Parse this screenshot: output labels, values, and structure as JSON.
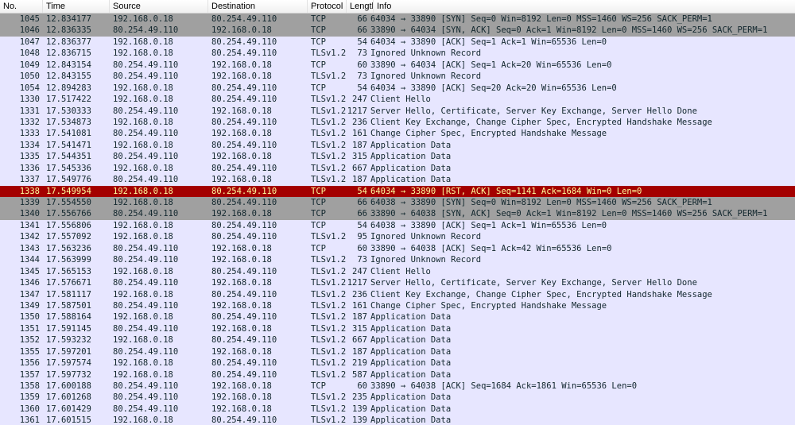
{
  "columns": {
    "no": "No.",
    "time": "Time",
    "source": "Source",
    "destination": "Destination",
    "protocol": "Protocol",
    "length": "Length",
    "info": "Info"
  },
  "colors": {
    "normal_bg": "#e7e6ff",
    "syn_bg": "#a0a0a0",
    "rst_bg": "#a40000",
    "rst_fg": "#fffc9c"
  },
  "packets": [
    {
      "no": "1045",
      "time": "12.834177",
      "src": "192.168.0.18",
      "dst": "80.254.49.110",
      "proto": "TCP",
      "len": "66",
      "info": "64034 → 33890 [SYN] Seq=0 Win=8192 Len=0 MSS=1460 WS=256 SACK_PERM=1",
      "style": "syn"
    },
    {
      "no": "1046",
      "time": "12.836335",
      "src": "80.254.49.110",
      "dst": "192.168.0.18",
      "proto": "TCP",
      "len": "66",
      "info": "33890 → 64034 [SYN, ACK] Seq=0 Ack=1 Win=8192 Len=0 MSS=1460 WS=256 SACK_PERM=1",
      "style": "syn"
    },
    {
      "no": "1047",
      "time": "12.836377",
      "src": "192.168.0.18",
      "dst": "80.254.49.110",
      "proto": "TCP",
      "len": "54",
      "info": "64034 → 33890 [ACK] Seq=1 Ack=1 Win=65536 Len=0",
      "style": "tcp"
    },
    {
      "no": "1048",
      "time": "12.836715",
      "src": "192.168.0.18",
      "dst": "80.254.49.110",
      "proto": "TLSv1.2",
      "len": "73",
      "info": "Ignored Unknown Record",
      "style": "tls"
    },
    {
      "no": "1049",
      "time": "12.843154",
      "src": "80.254.49.110",
      "dst": "192.168.0.18",
      "proto": "TCP",
      "len": "60",
      "info": "33890 → 64034 [ACK] Seq=1 Ack=20 Win=65536 Len=0",
      "style": "tcp"
    },
    {
      "no": "1050",
      "time": "12.843155",
      "src": "80.254.49.110",
      "dst": "192.168.0.18",
      "proto": "TLSv1.2",
      "len": "73",
      "info": "Ignored Unknown Record",
      "style": "tls"
    },
    {
      "no": "1054",
      "time": "12.894283",
      "src": "192.168.0.18",
      "dst": "80.254.49.110",
      "proto": "TCP",
      "len": "54",
      "info": "64034 → 33890 [ACK] Seq=20 Ack=20 Win=65536 Len=0",
      "style": "tcp"
    },
    {
      "no": "1330",
      "time": "17.517422",
      "src": "192.168.0.18",
      "dst": "80.254.49.110",
      "proto": "TLSv1.2",
      "len": "247",
      "info": "Client Hello",
      "style": "tls"
    },
    {
      "no": "1331",
      "time": "17.530333",
      "src": "80.254.49.110",
      "dst": "192.168.0.18",
      "proto": "TLSv1.2",
      "len": "1217",
      "info": "Server Hello, Certificate, Server Key Exchange, Server Hello Done",
      "style": "tls"
    },
    {
      "no": "1332",
      "time": "17.534873",
      "src": "192.168.0.18",
      "dst": "80.254.49.110",
      "proto": "TLSv1.2",
      "len": "236",
      "info": "Client Key Exchange, Change Cipher Spec, Encrypted Handshake Message",
      "style": "tls"
    },
    {
      "no": "1333",
      "time": "17.541081",
      "src": "80.254.49.110",
      "dst": "192.168.0.18",
      "proto": "TLSv1.2",
      "len": "161",
      "info": "Change Cipher Spec, Encrypted Handshake Message",
      "style": "tls"
    },
    {
      "no": "1334",
      "time": "17.541471",
      "src": "192.168.0.18",
      "dst": "80.254.49.110",
      "proto": "TLSv1.2",
      "len": "187",
      "info": "Application Data",
      "style": "tls"
    },
    {
      "no": "1335",
      "time": "17.544351",
      "src": "80.254.49.110",
      "dst": "192.168.0.18",
      "proto": "TLSv1.2",
      "len": "315",
      "info": "Application Data",
      "style": "tls"
    },
    {
      "no": "1336",
      "time": "17.545336",
      "src": "192.168.0.18",
      "dst": "80.254.49.110",
      "proto": "TLSv1.2",
      "len": "667",
      "info": "Application Data",
      "style": "tls"
    },
    {
      "no": "1337",
      "time": "17.549776",
      "src": "80.254.49.110",
      "dst": "192.168.0.18",
      "proto": "TLSv1.2",
      "len": "187",
      "info": "Application Data",
      "style": "tls"
    },
    {
      "no": "1338",
      "time": "17.549954",
      "src": "192.168.0.18",
      "dst": "80.254.49.110",
      "proto": "TCP",
      "len": "54",
      "info": "64034 → 33890 [RST, ACK] Seq=1141 Ack=1684 Win=0 Len=0",
      "style": "rst"
    },
    {
      "no": "1339",
      "time": "17.554550",
      "src": "192.168.0.18",
      "dst": "80.254.49.110",
      "proto": "TCP",
      "len": "66",
      "info": "64038 → 33890 [SYN] Seq=0 Win=8192 Len=0 MSS=1460 WS=256 SACK_PERM=1",
      "style": "syn"
    },
    {
      "no": "1340",
      "time": "17.556766",
      "src": "80.254.49.110",
      "dst": "192.168.0.18",
      "proto": "TCP",
      "len": "66",
      "info": "33890 → 64038 [SYN, ACK] Seq=0 Ack=1 Win=8192 Len=0 MSS=1460 WS=256 SACK_PERM=1",
      "style": "syn"
    },
    {
      "no": "1341",
      "time": "17.556806",
      "src": "192.168.0.18",
      "dst": "80.254.49.110",
      "proto": "TCP",
      "len": "54",
      "info": "64038 → 33890 [ACK] Seq=1 Ack=1 Win=65536 Len=0",
      "style": "tcp"
    },
    {
      "no": "1342",
      "time": "17.557092",
      "src": "192.168.0.18",
      "dst": "80.254.49.110",
      "proto": "TLSv1.2",
      "len": "95",
      "info": "Ignored Unknown Record",
      "style": "tls"
    },
    {
      "no": "1343",
      "time": "17.563236",
      "src": "80.254.49.110",
      "dst": "192.168.0.18",
      "proto": "TCP",
      "len": "60",
      "info": "33890 → 64038 [ACK] Seq=1 Ack=42 Win=65536 Len=0",
      "style": "tcp"
    },
    {
      "no": "1344",
      "time": "17.563999",
      "src": "80.254.49.110",
      "dst": "192.168.0.18",
      "proto": "TLSv1.2",
      "len": "73",
      "info": "Ignored Unknown Record",
      "style": "tls"
    },
    {
      "no": "1345",
      "time": "17.565153",
      "src": "192.168.0.18",
      "dst": "80.254.49.110",
      "proto": "TLSv1.2",
      "len": "247",
      "info": "Client Hello",
      "style": "tls"
    },
    {
      "no": "1346",
      "time": "17.576671",
      "src": "80.254.49.110",
      "dst": "192.168.0.18",
      "proto": "TLSv1.2",
      "len": "1217",
      "info": "Server Hello, Certificate, Server Key Exchange, Server Hello Done",
      "style": "tls"
    },
    {
      "no": "1347",
      "time": "17.581117",
      "src": "192.168.0.18",
      "dst": "80.254.49.110",
      "proto": "TLSv1.2",
      "len": "236",
      "info": "Client Key Exchange, Change Cipher Spec, Encrypted Handshake Message",
      "style": "tls"
    },
    {
      "no": "1349",
      "time": "17.587501",
      "src": "80.254.49.110",
      "dst": "192.168.0.18",
      "proto": "TLSv1.2",
      "len": "161",
      "info": "Change Cipher Spec, Encrypted Handshake Message",
      "style": "tls"
    },
    {
      "no": "1350",
      "time": "17.588164",
      "src": "192.168.0.18",
      "dst": "80.254.49.110",
      "proto": "TLSv1.2",
      "len": "187",
      "info": "Application Data",
      "style": "tls"
    },
    {
      "no": "1351",
      "time": "17.591145",
      "src": "80.254.49.110",
      "dst": "192.168.0.18",
      "proto": "TLSv1.2",
      "len": "315",
      "info": "Application Data",
      "style": "tls"
    },
    {
      "no": "1352",
      "time": "17.593232",
      "src": "192.168.0.18",
      "dst": "80.254.49.110",
      "proto": "TLSv1.2",
      "len": "667",
      "info": "Application Data",
      "style": "tls"
    },
    {
      "no": "1355",
      "time": "17.597201",
      "src": "80.254.49.110",
      "dst": "192.168.0.18",
      "proto": "TLSv1.2",
      "len": "187",
      "info": "Application Data",
      "style": "tls"
    },
    {
      "no": "1356",
      "time": "17.597574",
      "src": "192.168.0.18",
      "dst": "80.254.49.110",
      "proto": "TLSv1.2",
      "len": "219",
      "info": "Application Data",
      "style": "tls"
    },
    {
      "no": "1357",
      "time": "17.597732",
      "src": "192.168.0.18",
      "dst": "80.254.49.110",
      "proto": "TLSv1.2",
      "len": "587",
      "info": "Application Data",
      "style": "tls"
    },
    {
      "no": "1358",
      "time": "17.600188",
      "src": "80.254.49.110",
      "dst": "192.168.0.18",
      "proto": "TCP",
      "len": "60",
      "info": "33890 → 64038 [ACK] Seq=1684 Ack=1861 Win=65536 Len=0",
      "style": "tcp"
    },
    {
      "no": "1359",
      "time": "17.601268",
      "src": "80.254.49.110",
      "dst": "192.168.0.18",
      "proto": "TLSv1.2",
      "len": "235",
      "info": "Application Data",
      "style": "tls"
    },
    {
      "no": "1360",
      "time": "17.601429",
      "src": "80.254.49.110",
      "dst": "192.168.0.18",
      "proto": "TLSv1.2",
      "len": "139",
      "info": "Application Data",
      "style": "tls"
    },
    {
      "no": "1361",
      "time": "17.601515",
      "src": "192.168.0.18",
      "dst": "80.254.49.110",
      "proto": "TLSv1.2",
      "len": "139",
      "info": "Application Data",
      "style": "tls"
    }
  ]
}
